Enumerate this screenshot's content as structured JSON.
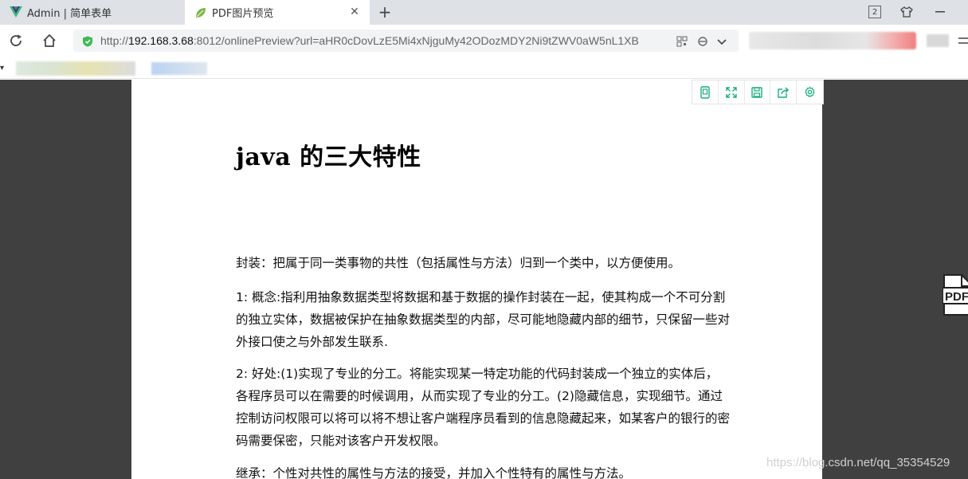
{
  "browser": {
    "tabs": [
      {
        "label": "Admin | 简单表单"
      },
      {
        "label": "PDF图片预览"
      }
    ],
    "tab_count": "2",
    "url_scheme": "http://",
    "url_host": "192.168.3.68",
    "url_rest": ":8012/onlinePreview?url=aHR0cDovLzE5Mi4xNjguMy42ODozMDY2Ni9tZWV0aW5nL1XB"
  },
  "document": {
    "title": "java 的三大特性",
    "paragraphs": [
      "封装：把属于同一类事物的共性（包括属性与方法）归到一个类中，以方便使用。",
      "1: 概念:指利用抽象数据类型将数据和基于数据的操作封装在一起，使其构成一个不可分割的独立实体，数据被保护在抽象数据类型的内部，尽可能地隐藏内部的细节，只保留一些对外接口使之与外部发生联系.",
      "2: 好处:(1)实现了专业的分工。将能实现某一特定功能的代码封装成一个独立的实体后，各程序员可以在需要的时候调用，从而实现了专业的分工。(2)隐藏信息，实现细节。通过控制访问权限可以将可以将不想让客户端程序员看到的信息隐藏起来，如某客户的银行的密码需要保密，只能对该客户开发权限。",
      "继承：个性对共性的属性与方法的接受，并加入个性特有的属性与方法。"
    ]
  },
  "side_icon_label": "PDF",
  "watermark": "https://blog.csdn.net/qq_35354529",
  "colors": {
    "tool_green": "#1aad7c",
    "viewer_bg": "#404040",
    "secure_green": "#3cba54"
  }
}
